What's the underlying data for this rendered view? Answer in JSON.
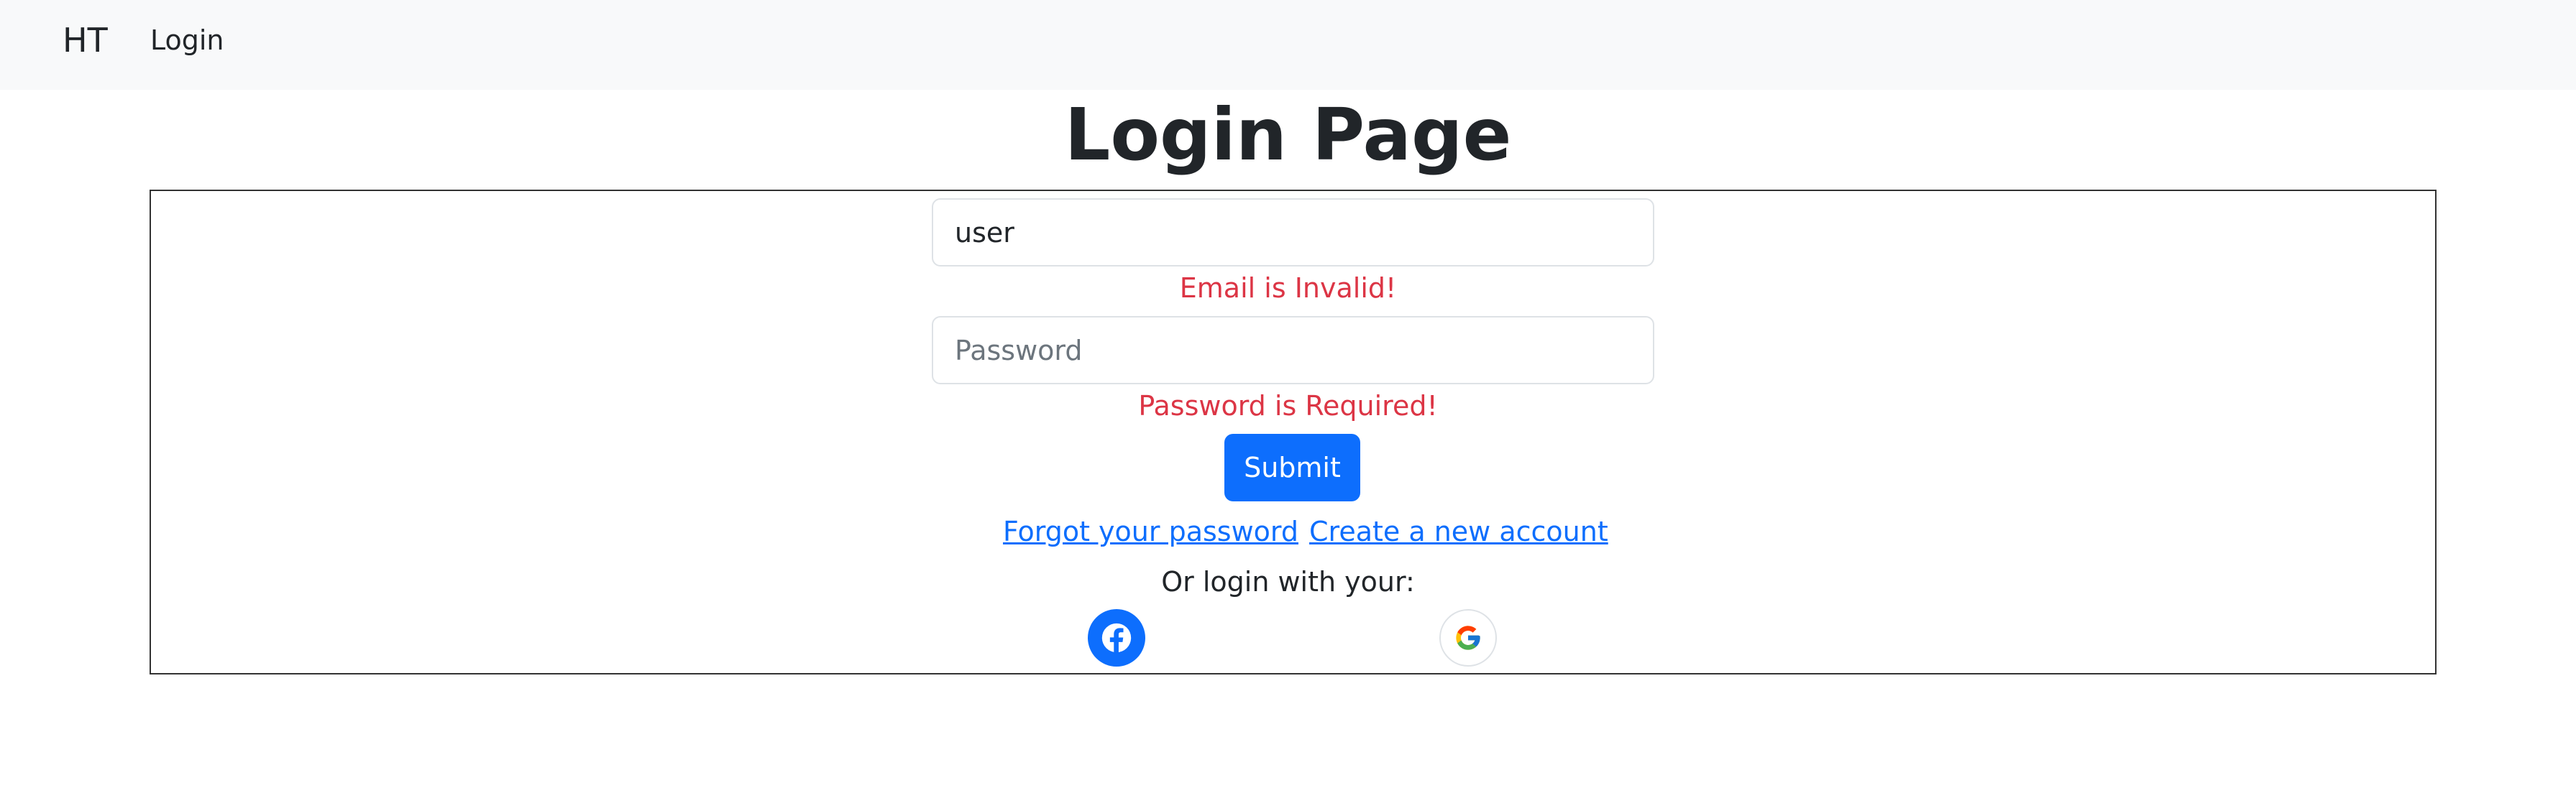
{
  "navbar": {
    "brand": "HT",
    "login_link": "Login"
  },
  "page": {
    "title": "Login Page"
  },
  "form": {
    "email_value": "user",
    "email_error": "Email is Invalid!",
    "password_value": "",
    "password_placeholder": "Password",
    "password_error": "Password is Required!",
    "submit_label": "Submit",
    "forgot_link": "Forgot your password",
    "create_link": "Create a new account",
    "or_login_text": "Or login with your:"
  },
  "social": {
    "facebook_icon": "facebook-icon",
    "google_icon": "google-icon"
  },
  "colors": {
    "primary": "#0d6efd",
    "danger": "#dc3545",
    "navbar_bg": "#f8f9fa",
    "text": "#212529"
  }
}
